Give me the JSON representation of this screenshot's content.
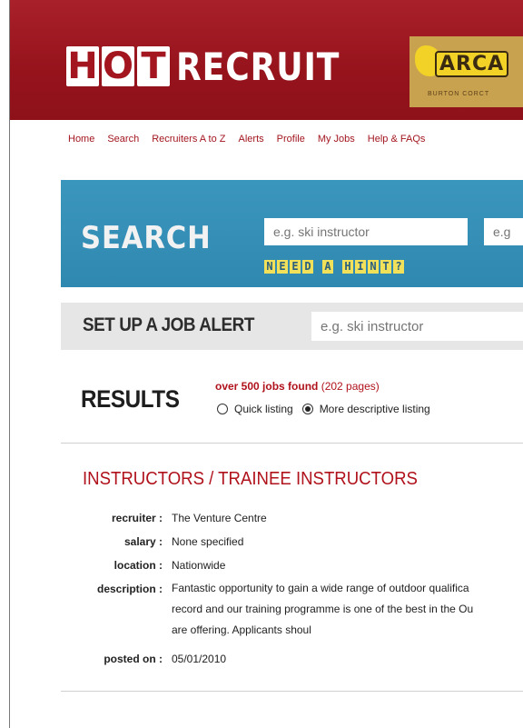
{
  "header": {
    "logo_box1": "H",
    "logo_box2": "O",
    "logo_box3": "T",
    "logo_rest": "RECRUIT",
    "sponsor_title": "ARCA",
    "sponsor_sub": "BURTON  CORCT"
  },
  "nav": {
    "items": [
      "Home",
      "Search",
      "Recruiters A to Z",
      "Alerts",
      "Profile",
      "My Jobs",
      "Help & FAQs"
    ]
  },
  "search": {
    "title": "SEARCH",
    "placeholder": "e.g. ski instructor",
    "placeholder2": "e.g",
    "hint": "NEED A HINT?"
  },
  "alert": {
    "title": "SET UP A JOB ALERT",
    "placeholder": "e.g. ski instructor"
  },
  "results": {
    "title": "RESULTS",
    "count_bold": "over 500 jobs found",
    "pages": "(202 pages)",
    "option_quick": "Quick listing",
    "option_descriptive": "More descriptive listing",
    "selected": "More descriptive listing"
  },
  "job": {
    "title": "INSTRUCTORS / TRAINEE INSTRUCTORS",
    "recruiter_label": "recruiter :",
    "recruiter": "The Venture Centre",
    "salary_label": "salary :",
    "salary": "None specified",
    "location_label": "location :",
    "location": "Nationwide",
    "description_label": "description :",
    "description_lines": [
      "Fantastic opportunity to gain a wide range of outdoor qualifica",
      "record and our training programme is one of the best in the Ou",
      "are offering. Applicants shoul"
    ],
    "posted_label": "posted on :",
    "posted": "05/01/2010"
  }
}
